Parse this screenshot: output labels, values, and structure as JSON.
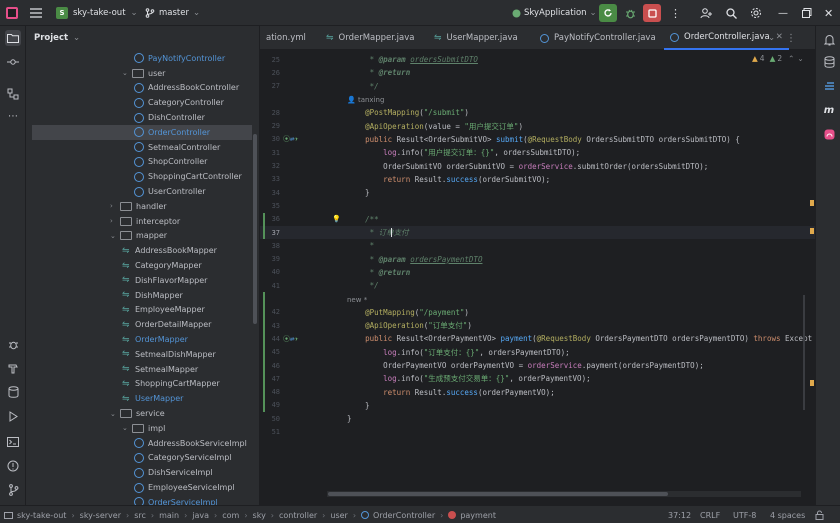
{
  "titlebar": {
    "badge": "S",
    "project": "sky-take-out",
    "branch": "master",
    "run_config": "SkyApplication"
  },
  "project_panel": {
    "title": "Project",
    "tree": [
      {
        "label": "PayNotifyController",
        "type": "class",
        "indent": 3,
        "blue": true
      },
      {
        "label": "user",
        "type": "dir",
        "indent": 2,
        "expanded": true
      },
      {
        "label": "AddressBookController",
        "type": "class",
        "indent": 3
      },
      {
        "label": "CategoryController",
        "type": "class",
        "indent": 3
      },
      {
        "label": "DishController",
        "type": "class",
        "indent": 3
      },
      {
        "label": "OrderController",
        "type": "class",
        "indent": 3,
        "blue": true,
        "selected": true
      },
      {
        "label": "SetmealController",
        "type": "class",
        "indent": 3
      },
      {
        "label": "ShopController",
        "type": "class",
        "indent": 3
      },
      {
        "label": "ShoppingCartController",
        "type": "class",
        "indent": 3
      },
      {
        "label": "UserController",
        "type": "class",
        "indent": 3
      },
      {
        "label": "handler",
        "type": "dir",
        "indent": 1,
        "expanded": false
      },
      {
        "label": "interceptor",
        "type": "dir",
        "indent": 1,
        "expanded": false
      },
      {
        "label": "mapper",
        "type": "dir",
        "indent": 1,
        "expanded": true
      },
      {
        "label": "AddressBookMapper",
        "type": "interface",
        "indent": 2
      },
      {
        "label": "CategoryMapper",
        "type": "interface",
        "indent": 2
      },
      {
        "label": "DishFlavorMapper",
        "type": "interface",
        "indent": 2
      },
      {
        "label": "DishMapper",
        "type": "interface",
        "indent": 2
      },
      {
        "label": "EmployeeMapper",
        "type": "interface",
        "indent": 2
      },
      {
        "label": "OrderDetailMapper",
        "type": "interface",
        "indent": 2
      },
      {
        "label": "OrderMapper",
        "type": "interface",
        "indent": 2,
        "blue": true
      },
      {
        "label": "SetmealDishMapper",
        "type": "interface",
        "indent": 2
      },
      {
        "label": "SetmealMapper",
        "type": "interface",
        "indent": 2
      },
      {
        "label": "ShoppingCartMapper",
        "type": "interface",
        "indent": 2
      },
      {
        "label": "UserMapper",
        "type": "interface",
        "indent": 2,
        "blue": true
      },
      {
        "label": "service",
        "type": "dir",
        "indent": 1,
        "expanded": true
      },
      {
        "label": "impl",
        "type": "dir",
        "indent": 2,
        "expanded": true
      },
      {
        "label": "AddressBookServiceImpl",
        "type": "class",
        "indent": 3
      },
      {
        "label": "CategoryServiceImpl",
        "type": "class",
        "indent": 3
      },
      {
        "label": "DishServiceImpl",
        "type": "class",
        "indent": 3
      },
      {
        "label": "EmployeeServiceImpl",
        "type": "class",
        "indent": 3
      },
      {
        "label": "OrderServiceImpl",
        "type": "class",
        "indent": 3,
        "blue": true
      }
    ]
  },
  "tabs": [
    {
      "label": "ation.yml",
      "icon": "none"
    },
    {
      "label": "OrderMapper.java",
      "icon": "interface"
    },
    {
      "label": "UserMapper.java",
      "icon": "interface"
    },
    {
      "label": "PayNotifyController.java",
      "icon": "class"
    },
    {
      "label": "OrderController.java",
      "icon": "class",
      "active": true
    }
  ],
  "inspections": {
    "warnings": "4",
    "weak_warnings": "2"
  },
  "editor": {
    "current_line": "37",
    "lines": [
      {
        "n": "25",
        "html": "     <span class=\"cm\">* </span><span class=\"tg\">@param</span><span class=\"cm\"> </span><span class=\"tu\">ordersSubmitDTO</span>"
      },
      {
        "n": "26",
        "html": "     <span class=\"cm\">* </span><span class=\"tg\">@return</span>"
      },
      {
        "n": "27",
        "html": "     <span class=\"cm\">*/</span>"
      },
      {
        "n": "",
        "hint": "tanxing"
      },
      {
        "n": "28",
        "html": "    <span class=\"a\">@PostMapping</span>(<span class=\"s\">\"/submit\"</span>)"
      },
      {
        "n": "29",
        "html": "    <span class=\"a\">@ApiOperation</span>(value = <span class=\"s\">\"用户提交订单\"</span>)"
      },
      {
        "n": "30",
        "html": "    <span class=\"k\">public</span> Result&lt;OrderSubmitVO&gt; <span class=\"f\">submit</span>(<span class=\"a\">@RequestBody</span> OrdersSubmitDTO ordersSubmitDTO) {"
      },
      {
        "n": "31",
        "html": "        <span class=\"fi\">log</span>.info(<span class=\"s\">\"用户提交订单：{}\"</span>, ordersSubmitDTO);"
      },
      {
        "n": "32",
        "html": "        OrderSubmitVO orderSubmitVO = <span class=\"fi\">orderService</span>.submitOrder(ordersSubmitDTO);"
      },
      {
        "n": "33",
        "html": "        <span class=\"k\">return</span> Result.<span class=\"f\">success</span>(orderSubmitVO);"
      },
      {
        "n": "34",
        "html": "    }"
      },
      {
        "n": "35",
        "html": ""
      },
      {
        "n": "36",
        "html": "    <span class=\"cm\">/**</span>"
      },
      {
        "n": "37",
        "html": "     <span class=\"cm\">* 订单支付</span>"
      },
      {
        "n": "38",
        "html": "     <span class=\"cm\">*</span>"
      },
      {
        "n": "39",
        "html": "     <span class=\"cm\">* </span><span class=\"tg\">@param</span><span class=\"cm\"> </span><span class=\"tu\">ordersPaymentDTO</span>"
      },
      {
        "n": "40",
        "html": "     <span class=\"cm\">* </span><span class=\"tg\">@return</span>"
      },
      {
        "n": "41",
        "html": "     <span class=\"cm\">*/</span>"
      },
      {
        "n": "",
        "hint": "new *"
      },
      {
        "n": "42",
        "html": "    <span class=\"a\">@PutMapping</span>(<span class=\"s\">\"/payment\"</span>)"
      },
      {
        "n": "43",
        "html": "    <span class=\"a\">@ApiOperation</span>(<span class=\"s\">\"订单支付\"</span>)"
      },
      {
        "n": "44",
        "html": "    <span class=\"k\">public</span> Result&lt;OrderPaymentVO&gt; <span class=\"f\">payment</span>(<span class=\"a\">@RequestBody</span> OrdersPaymentDTO ordersPaymentDTO) <span class=\"k\">throws</span> Except"
      },
      {
        "n": "45",
        "html": "        <span class=\"fi\">log</span>.info(<span class=\"s\">\"订单支付：{}\"</span>, ordersPaymentDTO);"
      },
      {
        "n": "46",
        "html": "        OrderPaymentVO orderPaymentVO = <span class=\"fi\">orderService</span>.payment(ordersPaymentDTO);"
      },
      {
        "n": "47",
        "html": "        <span class=\"fi\">log</span>.info(<span class=\"s\">\"生成预支付交易单：{}\"</span>, orderPaymentVO);"
      },
      {
        "n": "48",
        "html": "        <span class=\"k\">return</span> Result.<span class=\"f\">success</span>(orderPaymentVO);"
      },
      {
        "n": "49",
        "html": "    }"
      },
      {
        "n": "50",
        "html": "}"
      },
      {
        "n": "51",
        "html": ""
      }
    ]
  },
  "statusbar": {
    "breadcrumbs": [
      "sky-take-out",
      "sky-server",
      "src",
      "main",
      "java",
      "com",
      "sky",
      "controller",
      "user",
      "OrderController",
      "payment"
    ],
    "position": "37:12",
    "line_sep": "CRLF",
    "encoding": "UTF-8",
    "indent": "4 spaces"
  }
}
